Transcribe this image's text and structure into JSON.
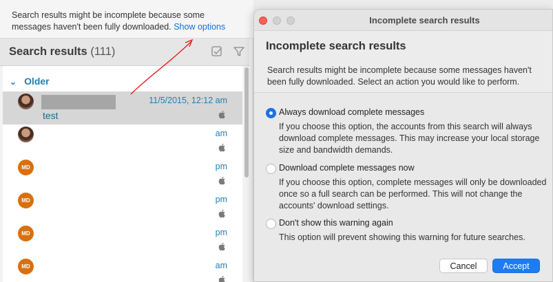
{
  "banner": {
    "text_line1": "Search results might be incomplete because some",
    "text_line2": "messages haven't been fully downloaded.",
    "link_label": "Show options"
  },
  "results": {
    "title": "Search results",
    "count": "(111)",
    "group_label": "Older",
    "rows": [
      {
        "avatar": "photo",
        "date": "11/5/2015, 12:12 am",
        "subject": "test",
        "selected": true
      },
      {
        "avatar": "photo",
        "date": "am",
        "subject": ""
      },
      {
        "avatar": "MD",
        "date": "pm",
        "subject": ""
      },
      {
        "avatar": "MD",
        "date": "pm",
        "subject": ""
      },
      {
        "avatar": "MD",
        "date": "pm",
        "subject": ""
      },
      {
        "avatar": "MD",
        "date": "am",
        "subject": ""
      }
    ]
  },
  "dialog": {
    "window_title": "Incomplete search results",
    "heading": "Incomplete search results",
    "description": "Search results might be incomplete because some messages haven't been fully downloaded. Select an action you would like to perform.",
    "options": [
      {
        "label": "Always download complete messages",
        "description": "If you choose this option, the accounts from this search will always download complete messages. This may increase your local storage size and bandwidth demands.",
        "selected": true
      },
      {
        "label": "Download complete messages now",
        "description": "If you choose this option, complete messages will only be downloaded once so a full search can be performed. This will not change the accounts' download settings.",
        "selected": false
      },
      {
        "label": "Don't show this warning again",
        "description": "This option will prevent showing this warning for future searches.",
        "selected": false
      }
    ],
    "cancel_label": "Cancel",
    "accept_label": "Accept"
  },
  "colors": {
    "accent": "#1d7cf2",
    "link": "#1a6fd1",
    "date_text": "#1f7fb2",
    "avatar_md": "#d9700f",
    "annotation_arrow": "#e2231a"
  },
  "icons": [
    "filter-icon",
    "select-all-icon",
    "apple-icon",
    "chevron-down-icon"
  ]
}
